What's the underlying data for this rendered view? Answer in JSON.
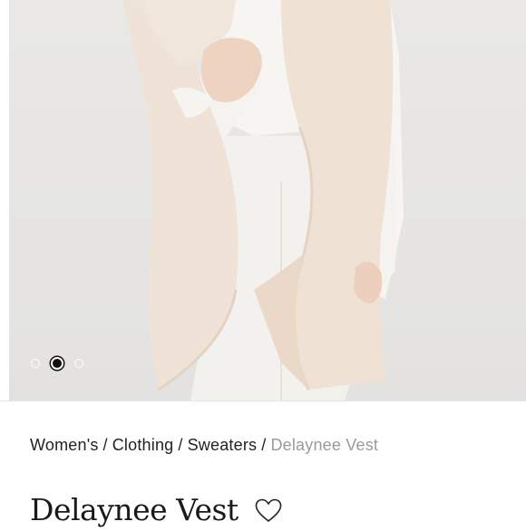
{
  "carousel": {
    "total": 3,
    "active_index": 1
  },
  "breadcrumb": {
    "items": [
      "Women's",
      "Clothing",
      "Sweaters"
    ],
    "current": "Delaynee Vest"
  },
  "product": {
    "title": "Delaynee Vest"
  },
  "icons": {
    "wishlist": "heart-outline-icon"
  },
  "colors": {
    "vest": "#efe3d7",
    "breadcrumb_current": "#9a9a9a"
  }
}
